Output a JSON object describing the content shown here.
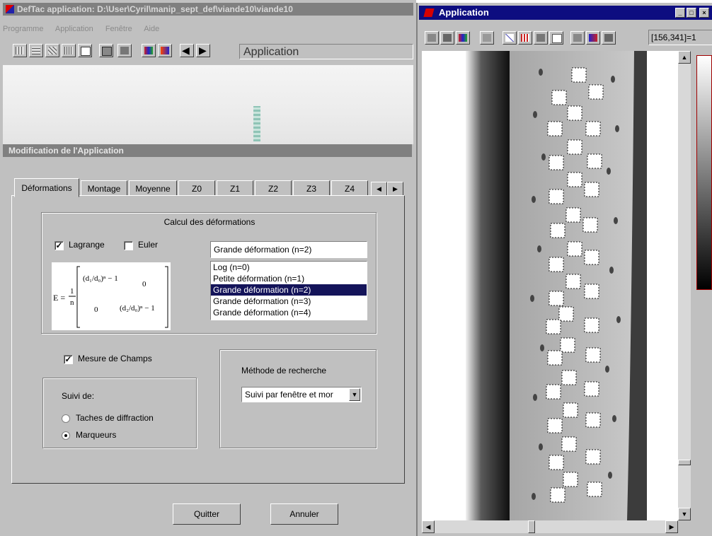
{
  "left_window": {
    "title": "DefTac application: D:\\User\\Cyril\\manip_sept_def\\viande10\\viande10",
    "menu": [
      "Programme",
      "Application",
      "Fenêtre",
      "Aide"
    ],
    "toolbar_label": "Application"
  },
  "dialog": {
    "title": "Modification de l'Application",
    "tabs": [
      "Déformations",
      "Montage",
      "Moyenne",
      "Z0",
      "Z1",
      "Z2",
      "Z3",
      "Z4"
    ],
    "active_tab": "Déformations",
    "calcul": {
      "group_title": "Calcul des déformations",
      "lagrange_label": "Lagrange",
      "lagrange_checked": true,
      "euler_label": "Euler",
      "euler_checked": false,
      "selected_value": "Grande déformation (n=2)",
      "options": [
        "Log (n=0)",
        "Petite déformation (n=1)",
        "Grande déformation (n=2)",
        "Grande déformation (n=3)",
        "Grande déformation (n=4)"
      ],
      "selected_index": 2
    },
    "mesure_label": "Mesure de Champs",
    "mesure_checked": true,
    "suivi": {
      "label": "Suivi de:",
      "option1": "Taches de diffraction",
      "option2": "Marqueurs",
      "selected": "Marqueurs"
    },
    "methode": {
      "label": "Méthode de recherche",
      "value": "Suivi par fenêtre et mor"
    },
    "quit_label": "Quitter",
    "cancel_label": "Annuler"
  },
  "right_window": {
    "title": "Application",
    "coord": "[156,341]=1"
  },
  "colors": {
    "title_active": "#0d0d80",
    "title_inactive": "#808080",
    "face": "#c0c0c0",
    "selection": "#14145a"
  }
}
